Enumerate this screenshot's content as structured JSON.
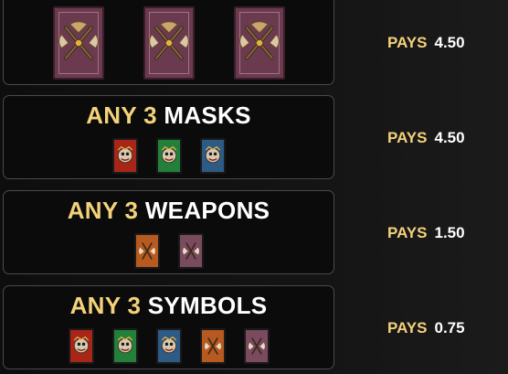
{
  "rows": [
    {
      "title_prefix": "",
      "title_count": "",
      "title_suffix": "",
      "icons": [
        "axe-card-icon",
        "axe-card-icon",
        "axe-card-icon"
      ],
      "pays_label": "PAYS",
      "pays_value": "4.50"
    },
    {
      "title_prefix": "ANY",
      "title_count": "3",
      "title_suffix": "MASKS",
      "icons": [
        "red-mask-icon",
        "green-mask-icon",
        "blue-mask-icon"
      ],
      "pays_label": "PAYS",
      "pays_value": "4.50"
    },
    {
      "title_prefix": "ANY",
      "title_count": "3",
      "title_suffix": "WEAPONS",
      "icons": [
        "orange-axe-icon",
        "purple-axe-icon"
      ],
      "pays_label": "PAYS",
      "pays_value": "1.50"
    },
    {
      "title_prefix": "ANY",
      "title_count": "3",
      "title_suffix": "SYMBOLS",
      "icons": [
        "red-mask-icon",
        "green-mask-icon",
        "blue-mask-icon",
        "orange-axe-icon",
        "purple-axe-icon"
      ],
      "pays_label": "PAYS",
      "pays_value": "0.75"
    }
  ],
  "colors": {
    "gold": "#f3d27a",
    "white": "#ffffff",
    "panel_bg": "#0b0b0b",
    "panel_border": "#4a4a4a",
    "mask_red": "#a82617",
    "mask_green": "#23803a",
    "mask_blue": "#2d5b86",
    "weapon_orange": "#b75a1f",
    "weapon_purple": "#7a4a5e"
  }
}
